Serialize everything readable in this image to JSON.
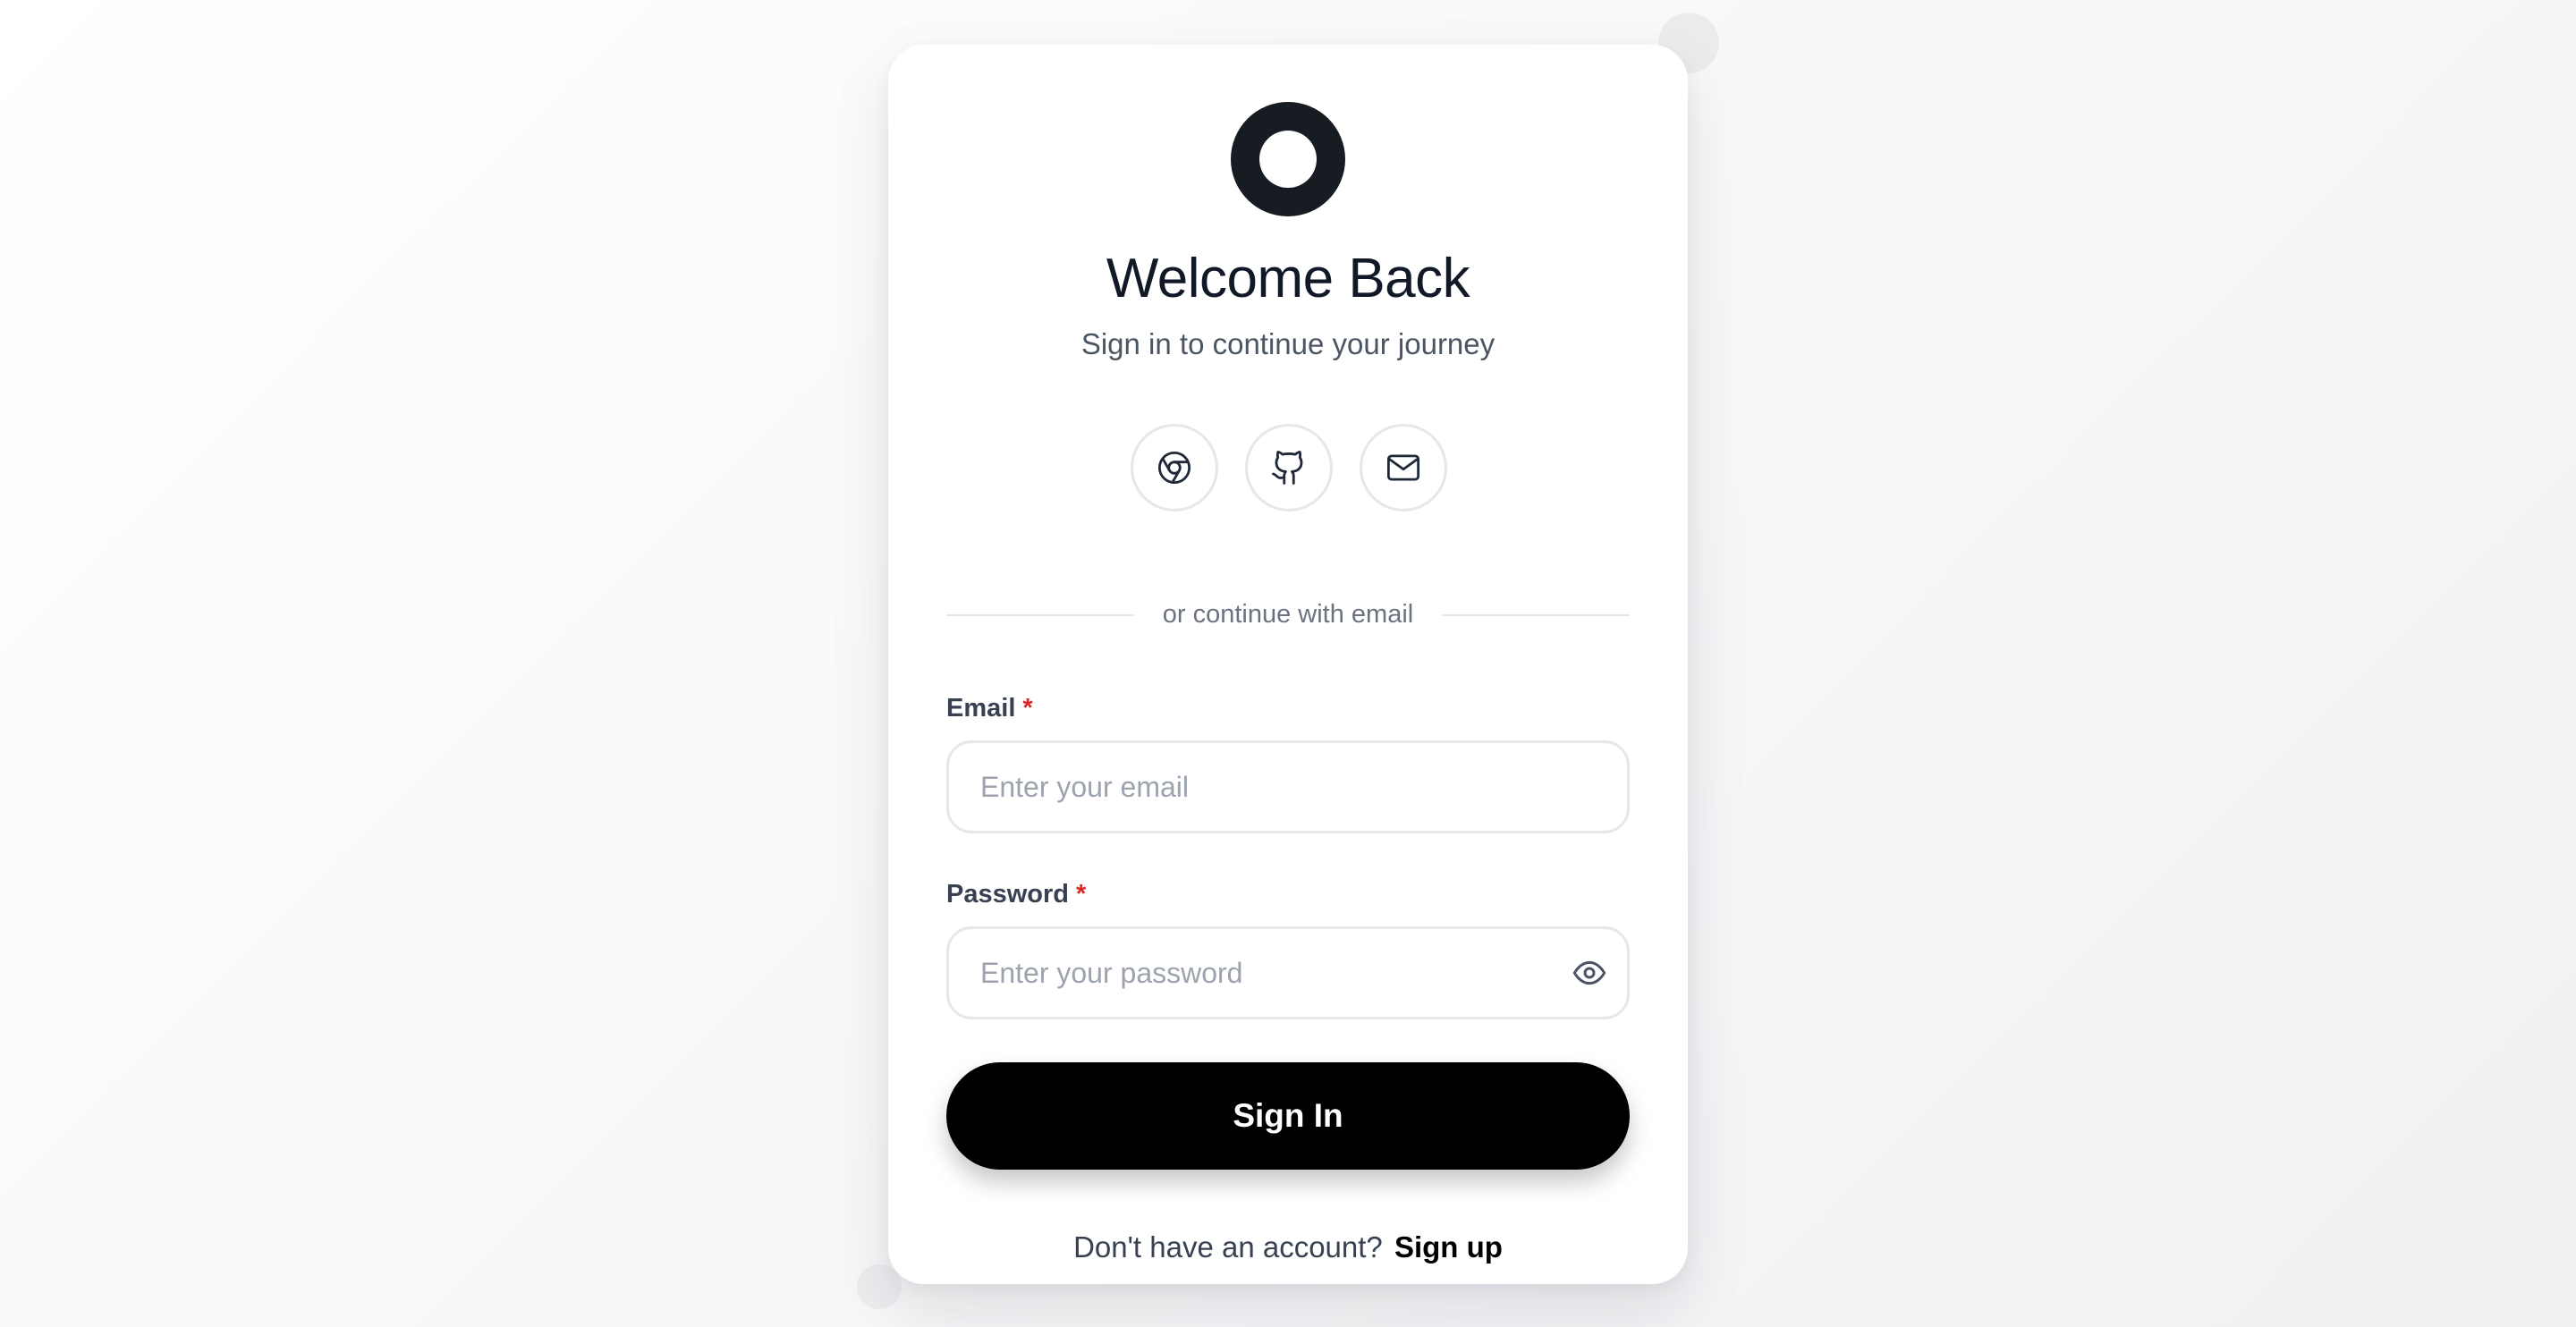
{
  "header": {
    "title": "Welcome Back",
    "subtitle": "Sign in to continue your journey"
  },
  "social": [
    {
      "icon": "chrome-icon"
    },
    {
      "icon": "github-icon"
    },
    {
      "icon": "mail-icon"
    }
  ],
  "divider_text": "or continue with email",
  "form": {
    "email": {
      "label": "Email",
      "required_marker": "*",
      "placeholder": "Enter your email",
      "value": ""
    },
    "password": {
      "label": "Password",
      "required_marker": "*",
      "placeholder": "Enter your password",
      "value": "",
      "toggle_icon": "eye-icon"
    },
    "submit_label": "Sign In"
  },
  "footer": {
    "prompt": "Don't have an account?",
    "link_label": "Sign up"
  },
  "colors": {
    "primary_button": "#000000",
    "logo": "#171b22",
    "required": "#dc2626",
    "border": "#e5e7eb",
    "muted_text": "#6b7280"
  }
}
